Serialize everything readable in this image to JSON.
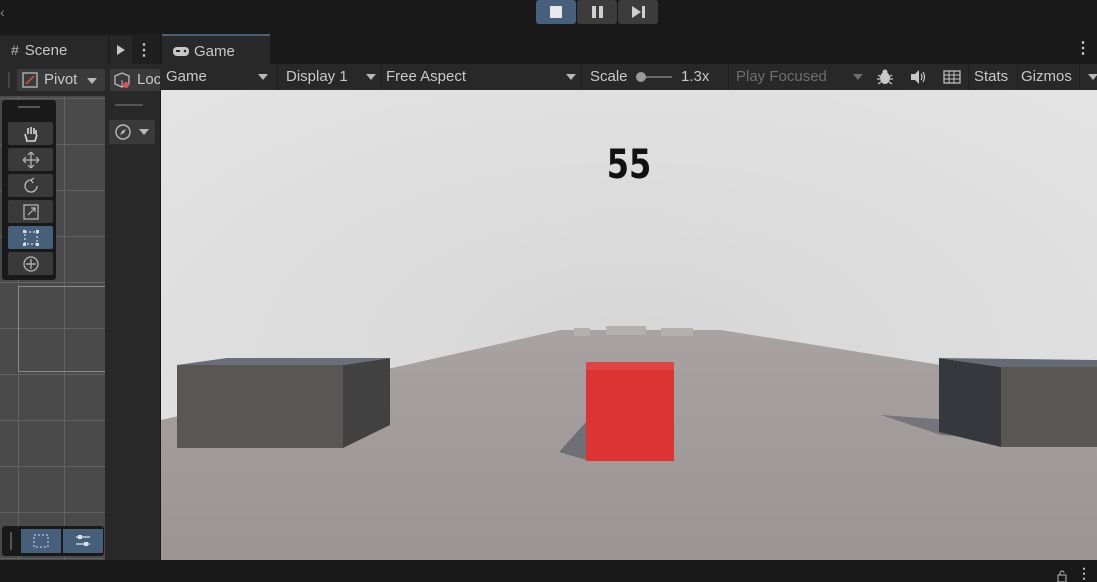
{
  "playbar": {
    "buttons": [
      {
        "name": "stop-button",
        "icon": "stop-icon",
        "active": true
      },
      {
        "name": "pause-button",
        "icon": "pause-icon",
        "active": false
      },
      {
        "name": "step-button",
        "icon": "step-icon",
        "active": false
      }
    ]
  },
  "scene_tab": {
    "label": "Scene"
  },
  "game_tab": {
    "label": "Game"
  },
  "scene_toolbar": {
    "pivot_label": "Pivot",
    "local_label": "Loc"
  },
  "game_toolbar": {
    "view_select": "Game",
    "display_select": "Display 1",
    "aspect_select": "Free Aspect",
    "scale_label": "Scale",
    "scale_value": "1.3x",
    "play_mode_select": "Play Focused",
    "stats_label": "Stats",
    "gizmos_label": "Gizmos"
  },
  "scene_tools": [
    {
      "name": "hand-tool",
      "icon": "hand-icon"
    },
    {
      "name": "move-tool",
      "icon": "move-icon"
    },
    {
      "name": "rotate-tool",
      "icon": "rotate-icon"
    },
    {
      "name": "scale-tool",
      "icon": "scale-icon"
    },
    {
      "name": "rect-tool",
      "icon": "rect-icon",
      "selected": true
    },
    {
      "name": "transform-tool",
      "icon": "transform-icon"
    }
  ],
  "game": {
    "score": "55",
    "player_color": "#e03a3a",
    "floor_color": "#a29d9d",
    "sky_color": "#d8d8d8"
  },
  "colors": {
    "accent": "#46607c",
    "panel": "#282828",
    "background": "#191919"
  }
}
